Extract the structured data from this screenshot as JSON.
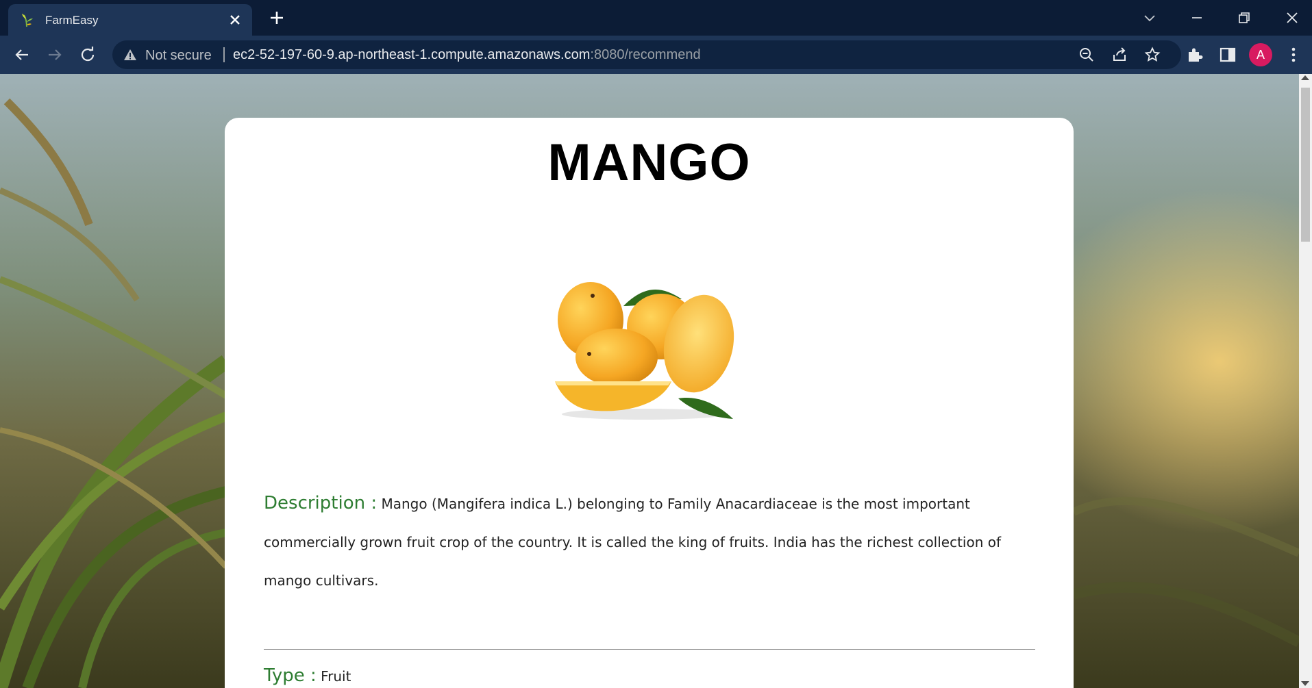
{
  "browser": {
    "tab": {
      "title": "FarmEasy",
      "favicon": "farmeasy-plant-icon"
    },
    "address": {
      "security_label": "Not secure",
      "url_host": "ec2-52-197-60-9.ap-northeast-1.compute.amazonaws.com",
      "url_rest": ":8080/recommend"
    },
    "profile_initial": "A",
    "accent_colors": {
      "tab_bar": "#0c1c36",
      "toolbar": "#1e3557",
      "avatar": "#d81b60"
    }
  },
  "page": {
    "crop_name": "MANGO",
    "image_alt": "mango-fruit-image",
    "description_label": "Description :",
    "description_text": "Mango (Mangifera indica L.) belonging to Family Anacardiaceae is the most important commercially grown fruit crop of the country. It is called the king of fruits. India has the richest collection of mango cultivars.",
    "type_label": "Type :",
    "type_value": "Fruit",
    "label_color": "#2e7d32"
  }
}
